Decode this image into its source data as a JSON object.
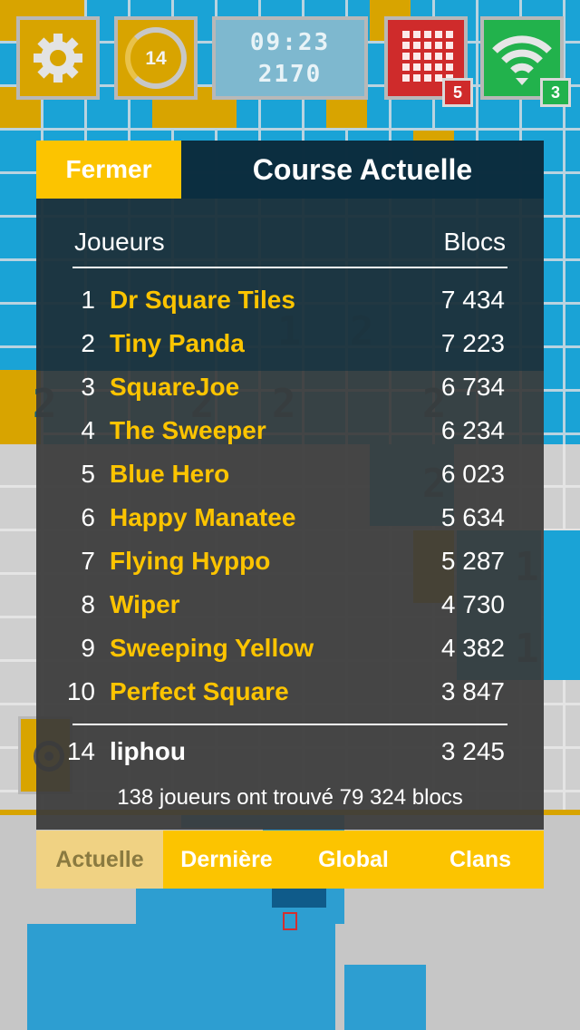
{
  "hud": {
    "timer_value": "14",
    "clock_time": "09:23",
    "clock_score": "2170",
    "grid_badge": "5",
    "wifi_badge": "3"
  },
  "board": {
    "numbers": [
      "1",
      "2",
      "2",
      "2",
      "2",
      "2",
      "2",
      "1",
      "1"
    ]
  },
  "panel": {
    "close_label": "Fermer",
    "title": "Course Actuelle",
    "col_players": "Joueurs",
    "col_blocks": "Blocs",
    "rows": [
      {
        "rank": "1",
        "name": "Dr Square Tiles",
        "score": "7 434"
      },
      {
        "rank": "2",
        "name": "Tiny Panda",
        "score": "7 223"
      },
      {
        "rank": "3",
        "name": "SquareJoe",
        "score": "6 734"
      },
      {
        "rank": "4",
        "name": "The Sweeper",
        "score": "6 234"
      },
      {
        "rank": "5",
        "name": "Blue Hero",
        "score": "6 023"
      },
      {
        "rank": "6",
        "name": "Happy Manatee",
        "score": "5 634"
      },
      {
        "rank": "7",
        "name": "Flying Hyppo",
        "score": "5 287"
      },
      {
        "rank": "8",
        "name": "Wiper",
        "score": "4 730"
      },
      {
        "rank": "9",
        "name": "Sweeping Yellow",
        "score": "4 382"
      },
      {
        "rank": "10",
        "name": "Perfect Square",
        "score": "3 847"
      }
    ],
    "me": {
      "rank": "14",
      "name": "liphou",
      "score": "3 245"
    },
    "summary": "138 joueurs ont trouvé 79 324 blocs"
  },
  "tabs": [
    {
      "label": "Actuelle",
      "active": true
    },
    {
      "label": "Dernière",
      "active": false
    },
    {
      "label": "Global",
      "active": false
    },
    {
      "label": "Clans",
      "active": false
    }
  ],
  "colors": {
    "accent_yellow": "#fcc400",
    "board_blue": "#1aa3d6",
    "badge_red": "#cf2b2b",
    "badge_green": "#22b24c"
  }
}
